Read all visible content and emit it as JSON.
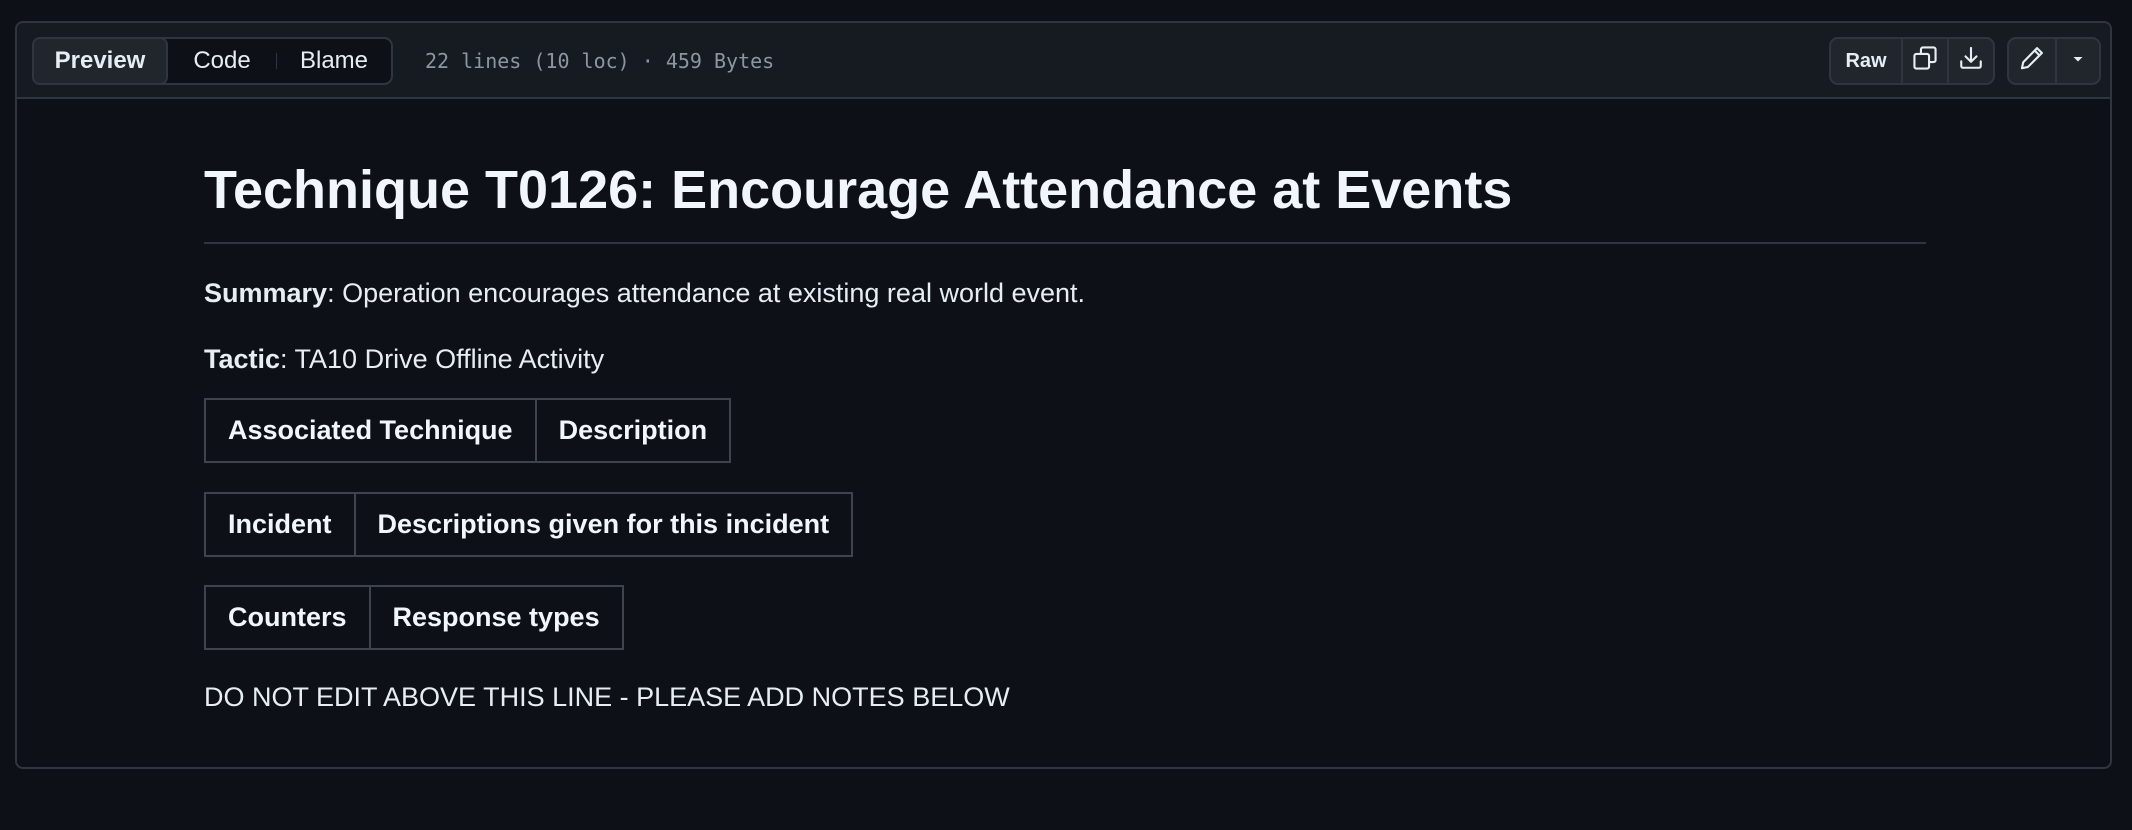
{
  "header": {
    "tabs": [
      {
        "label": "Preview",
        "active": true
      },
      {
        "label": "Code",
        "active": false
      },
      {
        "label": "Blame",
        "active": false
      }
    ],
    "file_info": "22 lines (10 loc) · 459 Bytes",
    "raw_label": "Raw",
    "icons": [
      "copy-icon",
      "download-icon",
      "pencil-icon",
      "triangle-down-icon"
    ]
  },
  "document": {
    "title": "Technique T0126: Encourage Attendance at Events",
    "summary_label": "Summary",
    "summary_text": ": Operation encourages attendance at existing real world event.",
    "tactic_label": "Tactic",
    "tactic_text": ": TA10 Drive Offline Activity",
    "tables": [
      {
        "headers": [
          "Associated Technique",
          "Description"
        ]
      },
      {
        "headers": [
          "Incident",
          "Descriptions given for this incident"
        ]
      },
      {
        "headers": [
          "Counters",
          "Response types"
        ]
      }
    ],
    "note": "DO NOT EDIT ABOVE THIS LINE - PLEASE ADD NOTES BELOW"
  },
  "colors": {
    "background": "#0d1117",
    "header_bg": "#161b22",
    "border": "#30363d",
    "text": "#e6edf3",
    "muted": "#8d96a0"
  }
}
